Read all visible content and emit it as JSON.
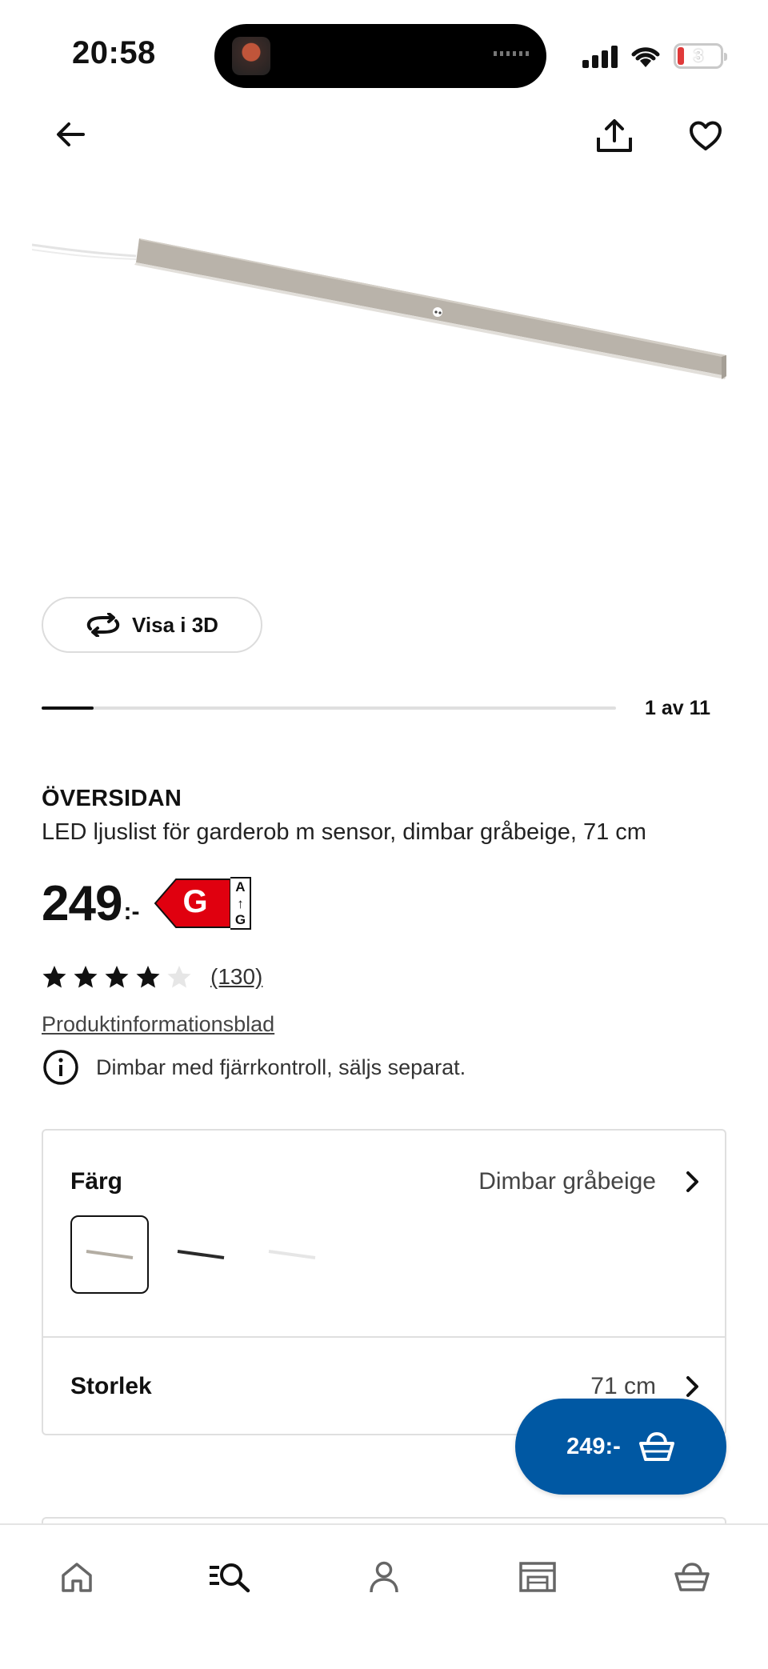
{
  "status_bar": {
    "time": "20:58",
    "battery": "3"
  },
  "nav": {
    "back_icon": "arrow-left-icon",
    "share_icon": "share-icon",
    "favorite_icon": "heart-icon"
  },
  "gallery": {
    "view_3d_label": "Visa i 3D",
    "page_indicator": "1 av 11",
    "current_image": 1,
    "total_images": 11
  },
  "product": {
    "name": "ÖVERSIDAN",
    "description": "LED ljuslist för garderob m sensor, dimbar gråbeige, 71 cm",
    "price": "249",
    "price_suffix": ":-",
    "energy_class": "G",
    "energy_scale_top": "A",
    "energy_scale_bottom": "G",
    "rating": 4,
    "rating_max": 5,
    "review_count": "(130)",
    "info_link": "Produktinformationsblad",
    "notice": "Dimbar med fjärrkontroll, säljs separat."
  },
  "options": {
    "color_label": "Färg",
    "color_value": "Dimbar gråbeige",
    "swatches": [
      "gråbeige",
      "svart",
      "vit"
    ],
    "size_label": "Storlek",
    "size_value": "71 cm"
  },
  "cart_button": {
    "label": "249:-"
  },
  "tabs": [
    {
      "name": "home",
      "icon": "home-icon"
    },
    {
      "name": "search",
      "icon": "search-icon",
      "active": true
    },
    {
      "name": "profile",
      "icon": "person-icon"
    },
    {
      "name": "store",
      "icon": "store-icon"
    },
    {
      "name": "cart",
      "icon": "basket-icon"
    }
  ],
  "colors": {
    "accent_blue": "#0058a3",
    "energy_red": "#e0000f",
    "text": "#111111"
  }
}
